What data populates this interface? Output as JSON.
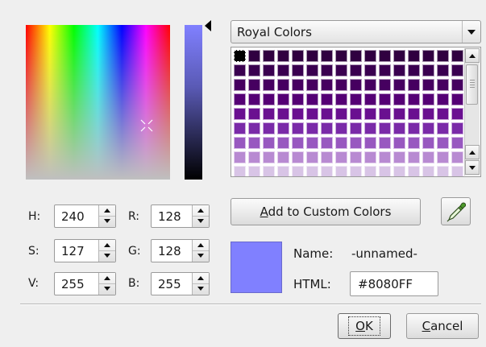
{
  "palette": {
    "selected": "Royal Colors",
    "swatch_base_colors": [
      "#300040",
      "#3a0050",
      "#460060",
      "#550075",
      "#6a1090",
      "#7a2aa8",
      "#9858c0",
      "#b88ad2",
      "#d8c4e6",
      "#f3efef",
      "#f7f4e6",
      "#fbf9d8"
    ]
  },
  "hsv": {
    "h_label": "H:",
    "h_value": "240",
    "s_label": "S:",
    "s_value": "127",
    "v_label": "V:",
    "v_value": "255"
  },
  "rgb": {
    "r_label": "R:",
    "r_value": "128",
    "g_label": "G:",
    "g_value": "128",
    "b_label": "B:",
    "b_value": "255"
  },
  "custom": {
    "add_prefix": "A",
    "add_rest": "dd to Custom Colors",
    "eyedropper_icon": "eyedropper-icon"
  },
  "current": {
    "color": "#8080ff",
    "name_label": "Name:",
    "name_value": "-unnamed-",
    "html_label": "HTML:",
    "html_value": "#8080FF"
  },
  "dialog": {
    "ok_prefix": "O",
    "ok_rest": "K",
    "cancel_prefix": "C",
    "cancel_rest": "ancel"
  }
}
